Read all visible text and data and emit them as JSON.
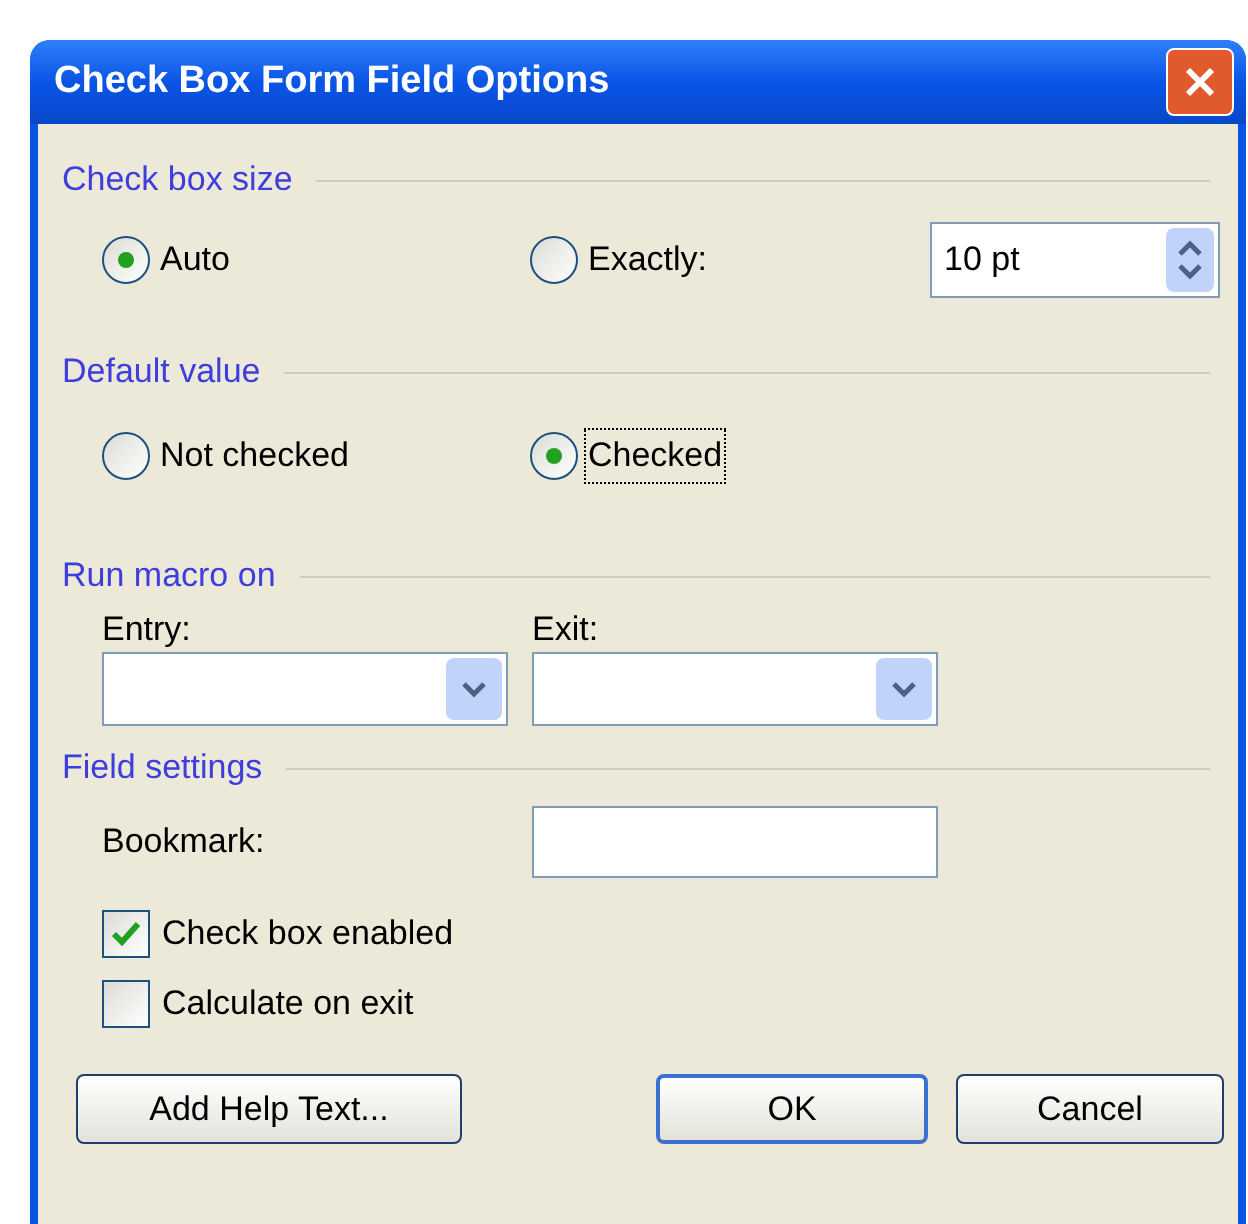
{
  "window": {
    "title": "Check Box Form Field Options"
  },
  "check_box_size": {
    "heading": "Check box size",
    "options": [
      {
        "label": "Auto",
        "selected": true,
        "focused": false
      },
      {
        "label": "Exactly:",
        "selected": false,
        "focused": false
      }
    ],
    "size_field": {
      "value": "10 pt"
    }
  },
  "default_value": {
    "heading": "Default value",
    "options": [
      {
        "label": "Not checked",
        "selected": false,
        "focused": false
      },
      {
        "label": "Checked",
        "selected": true,
        "focused": true
      }
    ]
  },
  "run_macro_on": {
    "heading": "Run macro on",
    "entry": {
      "label": "Entry:"
    },
    "exit": {
      "label": "Exit:"
    }
  },
  "field_settings": {
    "heading": "Field settings",
    "bookmark": {
      "label": "Bookmark:"
    },
    "checkboxes": [
      {
        "label": "Check box enabled",
        "checked": true
      },
      {
        "label": "Calculate on exit",
        "checked": false
      }
    ]
  },
  "buttons": [
    {
      "label": "Add Help Text...",
      "default": false
    },
    {
      "label": "OK",
      "default": true
    },
    {
      "label": "Cancel",
      "default": false
    }
  ]
}
